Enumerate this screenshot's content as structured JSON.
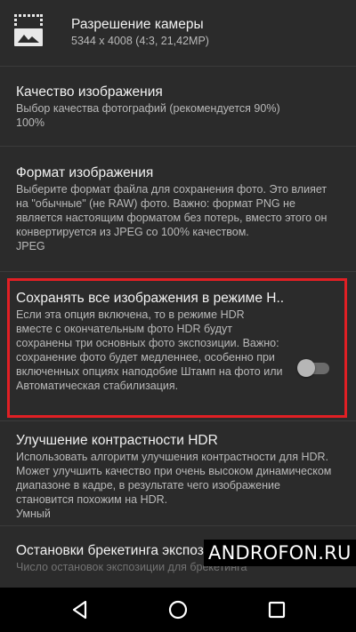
{
  "settings": {
    "items": [
      {
        "title": "Разрешение камеры",
        "summary": "5344 x 4008 (4:3, 21,42MP)",
        "icon": "image-resolution-icon"
      },
      {
        "title": "Качество изображения",
        "summary": "Выбор качества фотографий (рекомендуется 90%)",
        "value": "100%"
      },
      {
        "title": "Формат изображения",
        "summary": "Выберите формат файла для сохранения фото. Это влияет на \"обычные\" (не RAW) фото. Важно: формат PNG не является настоящим форматом без потерь, вместо этого он конвертируется из JPEG со 100% качеством.",
        "value": "JPEG"
      },
      {
        "title": "Сохранять все изображения в режиме Н..",
        "summary": "Если эта опция включена, то в режиме HDR вместе с окончательным фото HDR будут сохранены три основных фото экспозиции. Важно: сохранение фото будет медленнее, особенно при включенных опциях наподобие Штамп на фото или Автоматическая стабилизация.",
        "toggle_checked": false,
        "highlight_color": "#e11f24"
      },
      {
        "title": "Улучшение контрастности HDR",
        "summary": "Использовать алгоритм улучшения контрастности для HDR. Может улучшить качество при очень высоком динамическом диапазоне в кадре, в результате чего изображение становится похожим на HDR.",
        "value": "Умный"
      },
      {
        "title": "Остановки брекетинга экспозиции",
        "summary": "Число остановок экспозиции для брекетинга"
      }
    ]
  },
  "watermark": {
    "text": "ANDROFON.RU"
  },
  "navbar": {
    "back_icon": "back-triangle-icon",
    "home_icon": "home-circle-icon",
    "recents_icon": "recents-square-icon"
  },
  "colors": {
    "background": "#2b2b2b",
    "highlight": "#e11f24",
    "toggle_thumb": "#b6b6b6",
    "toggle_track": "#6b6b6b"
  }
}
